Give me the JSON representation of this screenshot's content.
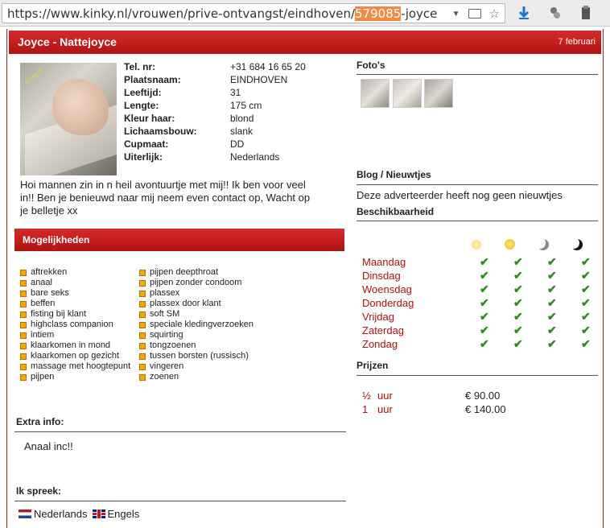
{
  "browser": {
    "url_prefix": "https://www.kinky.nl/vrouwen/prive-ontvangst/eindhoven/",
    "url_highlight": "579085",
    "url_suffix": "-joyce"
  },
  "profile": {
    "title": "Joyce - Nattejoyce",
    "date": "7 februari",
    "photo_watermark": "kinky.nl",
    "details": [
      {
        "k": "Tel. nr:",
        "v": "+31 684 16 65 20"
      },
      {
        "k": "Plaatsnaam:",
        "v": "EINDHOVEN"
      },
      {
        "k": "Leeftijd:",
        "v": "31"
      },
      {
        "k": "Lengte:",
        "v": "175 cm"
      },
      {
        "k": "Kleur haar:",
        "v": "blond"
      },
      {
        "k": "Lichaamsbouw:",
        "v": "slank"
      },
      {
        "k": "Cupmaat:",
        "v": "DD"
      },
      {
        "k": "Uiterlijk:",
        "v": "Nederlands"
      }
    ],
    "intro": "Hoi mannen zin in n heil avontuurtje met mij!! Ik ben voor veel in!! Ben je benieuwd naar mij neem even contact op, Wacht op je belletje xx"
  },
  "mogelijkheden": {
    "heading": "Mogelijkheden",
    "col1": [
      "aftrekken",
      "anaal",
      "bare seks",
      "beffen",
      "fisting bij klant",
      "highclass companion",
      "intiem",
      "klaarkomen in mond",
      "klaarkomen op gezicht",
      "massage met hoogtepunt",
      "pijpen"
    ],
    "col2": [
      "pijpen deepthroat",
      "pijpen zonder condoom",
      "plassex",
      "plassex door klant",
      "soft SM",
      "speciale kledingverzoeken",
      "squirting",
      "tongzoenen",
      "tussen borsten (russisch)",
      "vingeren",
      "zoenen"
    ]
  },
  "extra": {
    "heading": "Extra info:",
    "value": "Anaal inc!!"
  },
  "languages": {
    "heading": "Ik spreek:",
    "items": [
      "Nederlands",
      "Engels"
    ]
  },
  "right": {
    "fotos_heading": "Foto's",
    "blog_heading": "Blog / Nieuwtjes",
    "blog_text": "Deze adverteerder heeft nog geen nieuwtjes",
    "availability_heading": "Beschikbaarheid",
    "days": [
      "Maandag",
      "Dinsdag",
      "Woensdag",
      "Donderdag",
      "Vrijdag",
      "Zaterdag",
      "Zondag"
    ],
    "check_glyph": "✔",
    "prices_heading": "Prijzen",
    "prices": [
      {
        "amount": "½",
        "unit": "uur",
        "price": "€ 90.00"
      },
      {
        "amount": "1",
        "unit": "uur",
        "price": "€ 140.00"
      }
    ]
  },
  "colors": {
    "header_red": "#c41c1c",
    "day_red": "#b01010",
    "check_green": "#2e8b1e",
    "bullet_orange": "#f5a800"
  }
}
